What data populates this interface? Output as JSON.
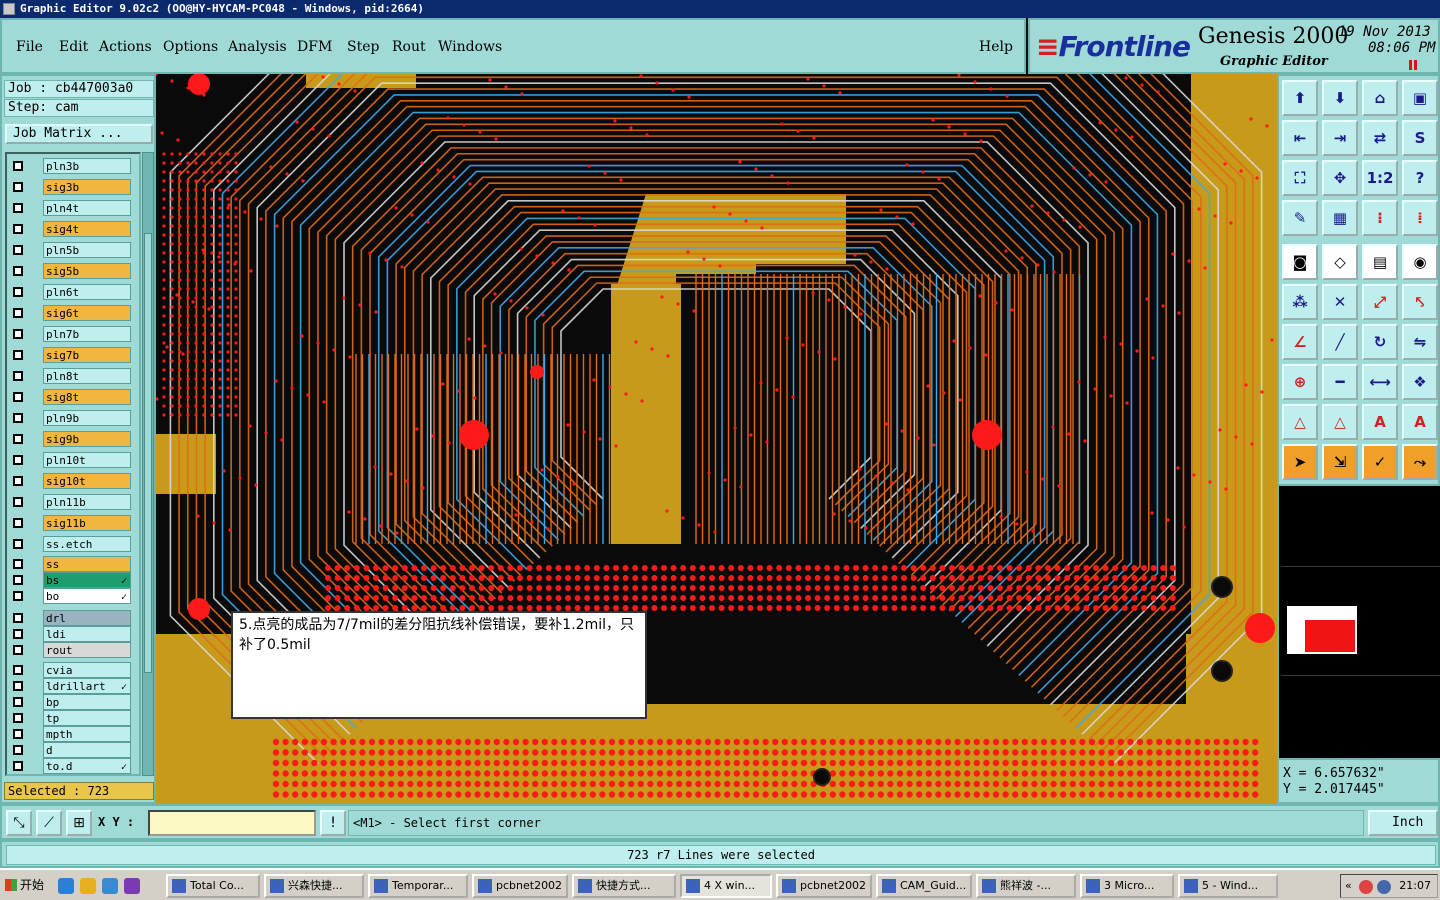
{
  "titlebar": {
    "text": "Graphic Editor 9.02c2 (OO@HY-HYCAM-PC048 - Windows, pid:2664)"
  },
  "menu": {
    "items": [
      "File",
      "Edit",
      "Actions",
      "Options",
      "Analysis",
      "DFM",
      "Step",
      "Rout",
      "Windows"
    ],
    "help": "Help"
  },
  "brand": {
    "logo": "Frontline",
    "product": "Genesis 2000",
    "subtitle": "Graphic Editor",
    "date": "19 Nov 2013",
    "time": "08:06 PM"
  },
  "left_panel": {
    "job": "Job : cb447003a0",
    "step": "Step: cam",
    "job_matrix": "Job Matrix ...",
    "selected": "Selected : 723",
    "layers": [
      {
        "name": "pln3b",
        "color": "#bfeeee"
      },
      {
        "name": "sig3b",
        "color": "#f0b640"
      },
      {
        "name": "pln4t",
        "color": "#bfeeee"
      },
      {
        "name": "sig4t",
        "color": "#f0b640"
      },
      {
        "name": "pln5b",
        "color": "#bfeeee"
      },
      {
        "name": "sig5b",
        "color": "#f0b640"
      },
      {
        "name": "pln6t",
        "color": "#bfeeee"
      },
      {
        "name": "sig6t",
        "color": "#f0b640"
      },
      {
        "name": "pln7b",
        "color": "#bfeeee"
      },
      {
        "name": "sig7b",
        "color": "#f0b640"
      },
      {
        "name": "pln8t",
        "color": "#bfeeee"
      },
      {
        "name": "sig8t",
        "color": "#f0b640"
      },
      {
        "name": "pln9b",
        "color": "#bfeeee"
      },
      {
        "name": "sig9b",
        "color": "#f0b640"
      },
      {
        "name": "pln10t",
        "color": "#bfeeee"
      },
      {
        "name": "sig10t",
        "color": "#f0b640"
      },
      {
        "name": "pln11b",
        "color": "#bfeeee"
      },
      {
        "name": "sig11b",
        "color": "#f0b640"
      },
      {
        "name": "ss.etch",
        "color": "#bfeeee"
      },
      {
        "name": "ss",
        "color": "#f0b640"
      },
      {
        "name": "bs",
        "color": "#1c9e6e",
        "flag": "✓"
      },
      {
        "name": "bo",
        "color": "#ffffff",
        "flag": "✓"
      },
      {
        "name": "drl",
        "color": "#9ab3c0"
      },
      {
        "name": "ldi",
        "color": "#bfeeee"
      },
      {
        "name": "rout",
        "color": "#d8d8d8"
      },
      {
        "name": "cvia",
        "color": "#bfeeee"
      },
      {
        "name": "ldrillart",
        "color": "#bfeeee",
        "flag": "✓"
      },
      {
        "name": "bp",
        "color": "#bfeeee"
      },
      {
        "name": "tp",
        "color": "#bfeeee"
      },
      {
        "name": "mpth",
        "color": "#bfeeee"
      },
      {
        "name": "d",
        "color": "#bfeeee"
      },
      {
        "name": "to.d",
        "color": "#bfeeee",
        "flag": "✓"
      }
    ]
  },
  "callout": {
    "text": "5.点亮的成品为7/7mil的差分阻抗线补偿错误，要补1.2mil，只补了0.5mil"
  },
  "tools": {
    "icons": [
      "open-job-icon",
      "save-icon",
      "home-icon",
      "window-icon",
      "prev-step-icon",
      "next-step-icon",
      "swap-icon",
      "redraw-icon",
      "zoom-fit-icon",
      "zoom-center-icon",
      "scale-1-2-icon",
      "help-icon",
      "snap-icon",
      "grid-icon",
      "measure-pads-icon",
      "measure-pair-icon",
      "fill-pad-icon",
      "edit-shape-icon",
      "ruler-icon",
      "circle-icon",
      "nodes-icon",
      "cross-icon",
      "connect-icon",
      "connect-alt-icon",
      "angle-icon",
      "slash-icon",
      "arc-icon",
      "flip-icon",
      "pad-add-icon",
      "line-icon",
      "dimension-icon",
      "group-icon",
      "triangle-icon",
      "triangle-up-icon",
      "triangle-a-icon",
      "triangle-b-icon",
      "pointer-icon",
      "pointer-frame-icon",
      "pointer-select-icon",
      "route-icon"
    ],
    "glyphs": [
      "⬆",
      "⬇",
      "⌂",
      "▣",
      "⇤",
      "⇥",
      "⇄",
      "S",
      "⛶",
      "✥",
      "1:2",
      "?",
      "✎",
      "▦",
      "⁝",
      "⁞",
      "◙",
      "◇",
      "▤",
      "◉",
      "⁂",
      "✕",
      "⤢",
      "⤣",
      "∠",
      "╱",
      "↻",
      "⇋",
      "⊕",
      "━",
      "⟷",
      "❖",
      "△",
      "△",
      "A",
      "A",
      "➤",
      "⇲",
      "✓",
      "⤳"
    ],
    "label_1_2": "1:2",
    "label_help": "?"
  },
  "coords": {
    "x": "X = 6.657632\"",
    "y": "Y = 2.017445\""
  },
  "command_bar": {
    "xy_label": "X Y :",
    "xy_value": "",
    "warn": "!",
    "prompt": "<M1> - Select first corner",
    "units": "Inch"
  },
  "status": {
    "message": "723 r7 Lines were selected"
  },
  "taskbar": {
    "start": "开始",
    "tasks": [
      "Total Co...",
      "兴森快捷...",
      "Temporar...",
      "pcbnet2002",
      "快捷方式...",
      "4 X win...",
      "pcbnet2002",
      "CAM_Guid...",
      "熊祥波 -...",
      "3 Micro...",
      "5 - Wind..."
    ],
    "clock": "21:07"
  },
  "colors": {
    "panel": "#9fdad6",
    "copper": "#c89a1a",
    "trace_orange": "#e06a16",
    "trace_blue": "#3fa8e8",
    "pad_red": "#ff1a1a"
  }
}
